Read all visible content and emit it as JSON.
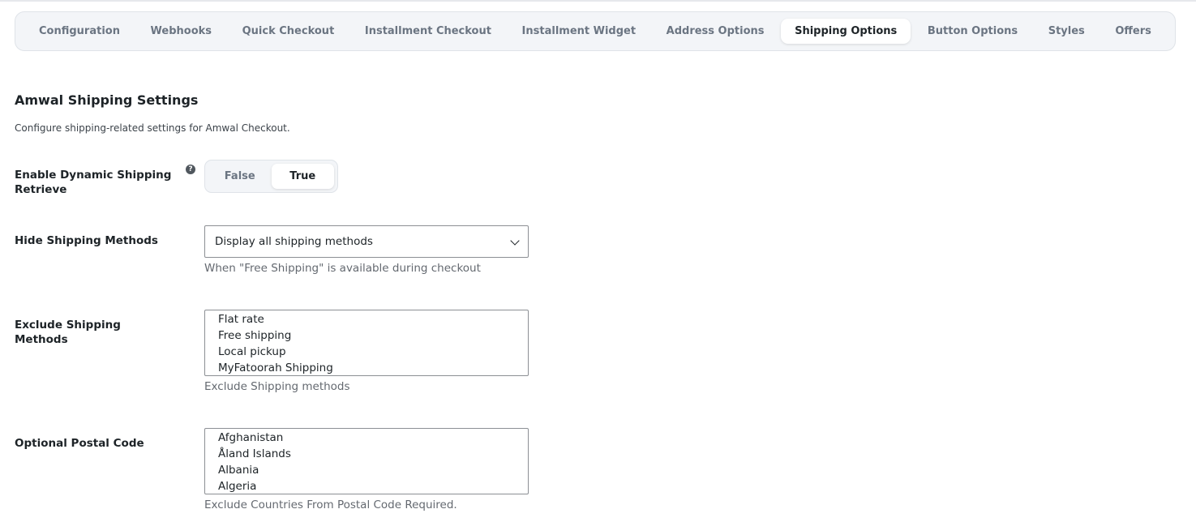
{
  "tabs": [
    {
      "label": "Configuration"
    },
    {
      "label": "Webhooks"
    },
    {
      "label": "Quick Checkout"
    },
    {
      "label": "Installment Checkout"
    },
    {
      "label": "Installment Widget"
    },
    {
      "label": "Address Options"
    },
    {
      "label": "Shipping Options",
      "active": true
    },
    {
      "label": "Button Options"
    },
    {
      "label": "Styles"
    },
    {
      "label": "Offers"
    }
  ],
  "section": {
    "title": "Amwal Shipping Settings",
    "description": "Configure shipping-related settings for Amwal Checkout."
  },
  "dynamic_shipping": {
    "label": "Enable Dynamic Shipping Retrieve",
    "help_icon": "?",
    "option_false": "False",
    "option_true": "True",
    "selected": "True"
  },
  "hide_shipping": {
    "label": "Hide Shipping Methods",
    "selected_value": "Display all shipping methods",
    "hint": "When \"Free Shipping\" is available during checkout"
  },
  "exclude_shipping": {
    "label": "Exclude Shipping Methods",
    "options": [
      "Flat rate",
      "Free shipping",
      "Local pickup",
      "MyFatoorah Shipping"
    ],
    "hint": "Exclude Shipping methods"
  },
  "postal_code": {
    "label": "Optional Postal Code",
    "options": [
      "Afghanistan",
      "Åland Islands",
      "Albania",
      "Algeria"
    ],
    "hint": "Exclude Countries From Postal Code Required."
  },
  "icons": {
    "help": "question-circle-icon",
    "dropdown": "chevron-down-icon"
  },
  "colors": {
    "active_tab_bg": "#ffffff",
    "tab_bar_bg": "#f3f5f8",
    "text": "#1d2327",
    "muted": "#646970"
  }
}
